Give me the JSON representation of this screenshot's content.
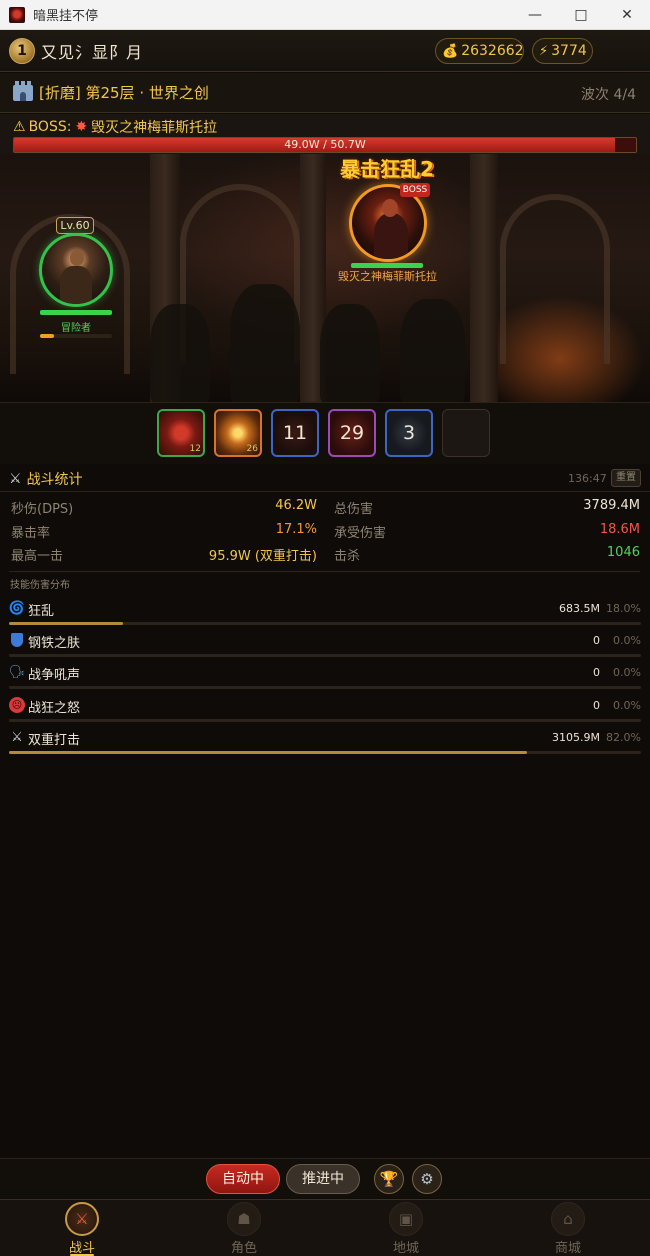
{
  "window": {
    "title": "暗黑挂不停"
  },
  "header": {
    "level": "1",
    "player_name": "又见氵显阝月",
    "gold": "2632662",
    "energy": "3774"
  },
  "stage": {
    "title": "[折磨] 第25层 · 世界之创",
    "wave": "波次 4/4"
  },
  "boss": {
    "label": "BOSS:",
    "name": "毁灭之神梅菲斯托拉",
    "hp_text": "49.0W / 50.7W",
    "hp_fraction": 0.966,
    "tag": "BOSS",
    "small_hp_fraction": 1.0
  },
  "float_text": "暴击狂乱2",
  "hero": {
    "level": "Lv.60",
    "name": "冒险者",
    "hp_fraction": 1.0,
    "energy_fraction": 0.2
  },
  "skill_slots": [
    {
      "kind": "rage",
      "count": "12",
      "label": ""
    },
    {
      "kind": "burst",
      "count": "26",
      "label": ""
    },
    {
      "kind": "cooldown",
      "count": "",
      "label": "11"
    },
    {
      "kind": "cooldown",
      "count": "",
      "label": "29"
    },
    {
      "kind": "cooldown",
      "count": "",
      "label": "3"
    },
    {
      "kind": "empty",
      "count": "",
      "label": ""
    }
  ],
  "stats": {
    "title": "战斗统计",
    "time": "136:47",
    "reset_label": "重置",
    "dps_label": "秒伤(DPS)",
    "dps_value": "46.2W",
    "total_label": "总伤害",
    "total_value": "3789.4M",
    "crit_label": "暴击率",
    "crit_value": "17.1%",
    "taken_label": "承受伤害",
    "taken_value": "18.6M",
    "max_label": "最高一击",
    "max_value": "95.9W (双重打击)",
    "kills_label": "击杀",
    "kills_value": "1046",
    "dist_title": "技能伤害分布"
  },
  "skill_damage": [
    {
      "icon": "swirl-icon",
      "name": "狂乱",
      "damage": "683.5M",
      "percent": "18.0%",
      "fraction": 0.18
    },
    {
      "icon": "shield-icon",
      "name": "钢铁之肤",
      "damage": "0",
      "percent": "0.0%",
      "fraction": 0.0
    },
    {
      "icon": "shout-icon",
      "name": "战争吼声",
      "damage": "0",
      "percent": "0.0%",
      "fraction": 0.0
    },
    {
      "icon": "rage-face-icon",
      "name": "战狂之怒",
      "damage": "0",
      "percent": "0.0%",
      "fraction": 0.0
    },
    {
      "icon": "crossed-swords-icon",
      "name": "双重打击",
      "damage": "3105.9M",
      "percent": "82.0%",
      "fraction": 0.82
    }
  ],
  "controls": {
    "auto_label": "自动中",
    "push_label": "推进中"
  },
  "nav": [
    {
      "label": "战斗",
      "active": true
    },
    {
      "label": "角色",
      "active": false
    },
    {
      "label": "地城",
      "active": false
    },
    {
      "label": "商城",
      "active": false
    }
  ],
  "colors": {
    "accent_gold": "#f1c64c",
    "hp_red": "#d63a2e",
    "hp_green": "#3bd24d",
    "auto_red": "#c62a22"
  }
}
